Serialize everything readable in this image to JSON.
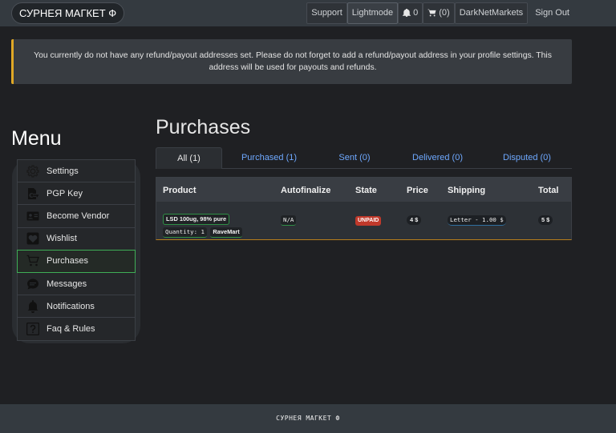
{
  "navbar": {
    "brand": "СУРНЕЯ МАГКЕТ Ф",
    "support": "Support",
    "lightmode": "Lightmode",
    "notifications_count": "0",
    "cart_count": "(0)",
    "darknetmarkets": "DarkNetMarkets",
    "signout": "Sign Out"
  },
  "alert": {
    "message": "You currently do not have any refund/payout addresses set. Please do not forget to add a refund/payout address in your profile settings. This address will be used for payouts and refunds."
  },
  "sidebar": {
    "title": "Menu",
    "items": [
      {
        "label": "Settings",
        "icon": "gear-icon"
      },
      {
        "label": "PGP Key",
        "icon": "key-document-icon"
      },
      {
        "label": "Become Vendor",
        "icon": "id-card-icon"
      },
      {
        "label": "Wishlist",
        "icon": "heart-icon"
      },
      {
        "label": "Purchases",
        "icon": "cart-icon",
        "active": true
      },
      {
        "label": "Messages",
        "icon": "chat-icon"
      },
      {
        "label": "Notifications",
        "icon": "bell-icon"
      },
      {
        "label": "Faq & Rules",
        "icon": "question-icon"
      }
    ]
  },
  "main": {
    "title": "Purchases",
    "tabs": [
      {
        "label": "All (1)",
        "active": true
      },
      {
        "label": "Purchased (1)"
      },
      {
        "label": "Sent (0)"
      },
      {
        "label": "Delivered (0)"
      },
      {
        "label": "Disputed (0)"
      }
    ],
    "table": {
      "headers": [
        "Product",
        "Autofinalize",
        "State",
        "Price",
        "Shipping",
        "Total"
      ],
      "rows": [
        {
          "product": "LSD 100ug, 98% pure",
          "quantity": "Quantity: 1",
          "vendor": "RaveMart",
          "autofinalize": "N/A",
          "state": "UNPAID",
          "price": "4 $",
          "shipping": "Letter - 1.00 $",
          "total": "5 $"
        }
      ]
    }
  },
  "footer": {
    "text": "СУРНЕЯ МАГКЕТ Ф"
  },
  "colors": {
    "accent_green": "#3fae56",
    "alert_yellow": "#e0a826",
    "link_blue": "#6ea8fe",
    "unpaid_red": "#c0392b"
  }
}
